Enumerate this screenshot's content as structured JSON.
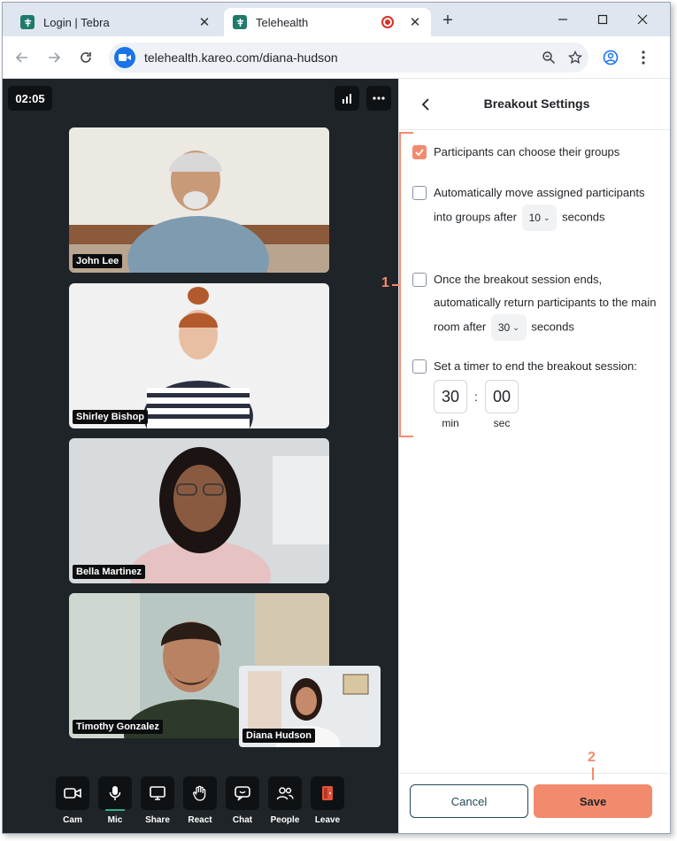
{
  "browser": {
    "tabs": [
      {
        "title": "Login | Tebra",
        "active": false
      },
      {
        "title": "Telehealth",
        "active": true,
        "recording": true
      }
    ],
    "url": "telehealth.kareo.com/diana-hudson"
  },
  "call": {
    "timer": "02:05",
    "participants": [
      {
        "name": "John Lee"
      },
      {
        "name": "Shirley Bishop"
      },
      {
        "name": "Bella Martinez"
      },
      {
        "name": "Timothy Gonzalez"
      }
    ],
    "self_view": {
      "name": "Diana Hudson"
    },
    "controls": [
      {
        "label": "Cam",
        "icon": "camera-icon"
      },
      {
        "label": "Mic",
        "icon": "microphone-icon"
      },
      {
        "label": "Share",
        "icon": "share-screen-icon"
      },
      {
        "label": "React",
        "icon": "hand-icon"
      },
      {
        "label": "Chat",
        "icon": "chat-icon"
      },
      {
        "label": "People",
        "icon": "people-icon"
      },
      {
        "label": "Leave",
        "icon": "leave-icon"
      }
    ]
  },
  "breakout": {
    "title": "Breakout Settings",
    "options": {
      "choose_groups": {
        "label": "Participants can choose their groups",
        "checked": true
      },
      "auto_move": {
        "text_before": "Automatically move assigned participants into groups after",
        "value": "10",
        "text_after": "seconds",
        "checked": false
      },
      "auto_return": {
        "text_before": "Once the breakout session ends, automatically return participants to the main room after",
        "value": "30",
        "text_after": "seconds",
        "checked": false
      },
      "timer": {
        "label": "Set a timer to end the breakout session:",
        "minutes": "30",
        "seconds": "00",
        "min_label": "min",
        "sec_label": "sec",
        "checked": false
      }
    },
    "cancel_label": "Cancel",
    "save_label": "Save"
  },
  "annotations": {
    "marker_1": "1",
    "marker_2": "2"
  },
  "colors": {
    "accent": "#f28b6e",
    "video_bg": "#1f2428",
    "cancel_border": "#24485a"
  }
}
